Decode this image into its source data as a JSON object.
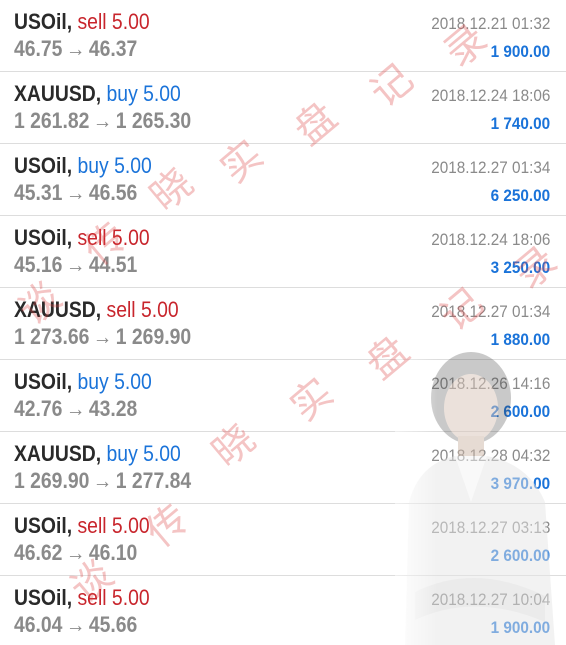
{
  "trades": [
    {
      "symbol": "USOil",
      "side": "sell 5.00",
      "side_color": "#c8252c",
      "open_price": "46.75",
      "close_price": "46.37",
      "time": "2018.12.21 01:32",
      "profit": "1 900.00"
    },
    {
      "symbol": "XAUUSD",
      "side": "buy 5.00",
      "side_color": "#1a73d9",
      "open_price": "1 261.82",
      "close_price": "1 265.30",
      "time": "2018.12.24 18:06",
      "profit": "1 740.00"
    },
    {
      "symbol": "USOil",
      "side": "buy 5.00",
      "side_color": "#1a73d9",
      "open_price": "45.31",
      "close_price": "46.56",
      "time": "2018.12.27 01:34",
      "profit": "6 250.00"
    },
    {
      "symbol": "USOil",
      "side": "sell 5.00",
      "side_color": "#c8252c",
      "open_price": "45.16",
      "close_price": "44.51",
      "time": "2018.12.24 18:06",
      "profit": "3 250.00"
    },
    {
      "symbol": "XAUUSD",
      "side": "sell 5.00",
      "side_color": "#c8252c",
      "open_price": "1 273.66",
      "close_price": "1 269.90",
      "time": "2018.12.27 01:34",
      "profit": "1 880.00"
    },
    {
      "symbol": "USOil",
      "side": "buy 5.00",
      "side_color": "#1a73d9",
      "open_price": "42.76",
      "close_price": "43.28",
      "time": "2018.12.26 14:16",
      "profit": "2 600.00"
    },
    {
      "symbol": "XAUUSD",
      "side": "buy 5.00",
      "side_color": "#1a73d9",
      "open_price": "1 269.90",
      "close_price": "1 277.84",
      "time": "2018.12.28 04:32",
      "profit": "3 970.00"
    },
    {
      "symbol": "USOil",
      "side": "sell 5.00",
      "side_color": "#c8252c",
      "open_price": "46.62",
      "close_price": "46.10",
      "time": "2018.12.27 03:13",
      "profit": "2 600.00"
    },
    {
      "symbol": "USOil",
      "side": "sell 5.00",
      "side_color": "#c8252c",
      "open_price": "46.04",
      "close_price": "45.66",
      "time": "2018.12.27 10:04",
      "profit": "1 900.00"
    }
  ],
  "punctuation": {
    "comma": ",",
    "arrow": "→"
  },
  "watermark": {
    "text": "谈传晓实盘记录",
    "chars": [
      "谈",
      "传",
      "晓",
      "实",
      "盘",
      "记",
      "录"
    ]
  }
}
